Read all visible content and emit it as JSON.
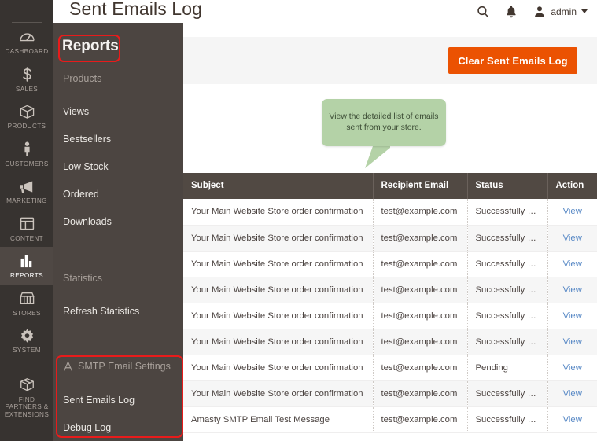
{
  "header": {
    "title": "Sent Emails Log",
    "search_icon": "search-icon",
    "notifications_icon": "bell-icon",
    "account_icon": "user-icon",
    "account_name": "admin",
    "caret_icon": "chevron-down-icon"
  },
  "rail": {
    "items": [
      {
        "label": "DASHBOARD",
        "icon": "dashboard-gauge-icon",
        "active": false
      },
      {
        "label": "SALES",
        "icon": "dollar-icon",
        "active": false
      },
      {
        "label": "PRODUCTS",
        "icon": "box-icon",
        "active": false
      },
      {
        "label": "CUSTOMERS",
        "icon": "person-icon",
        "active": false
      },
      {
        "label": "MARKETING",
        "icon": "megaphone-icon",
        "active": false
      },
      {
        "label": "CONTENT",
        "icon": "layout-icon",
        "active": false
      },
      {
        "label": "REPORTS",
        "icon": "bar-chart-icon",
        "active": true
      },
      {
        "label": "STORES",
        "icon": "storefront-icon",
        "active": false
      },
      {
        "label": "SYSTEM",
        "icon": "gear-icon",
        "active": false
      },
      {
        "label": "FIND PARTNERS & EXTENSIONS",
        "icon": "open-box-icon",
        "active": false
      }
    ]
  },
  "submenu": {
    "title": "Reports",
    "group_products": "Products",
    "link_views": "Views",
    "link_bestsellers": "Bestsellers",
    "link_low_stock": "Low Stock",
    "link_ordered": "Ordered",
    "link_downloads": "Downloads",
    "group_statistics": "Statistics",
    "link_refresh_statistics": "Refresh Statistics",
    "group_smtp": "SMTP Email Settings",
    "smtp_icon": "amasty-a-icon",
    "link_sent_emails_log": "Sent Emails Log",
    "link_debug_log": "Debug Log"
  },
  "toolbar": {
    "clear_label": "Clear Sent Emails Log",
    "accent_color": "#eb5202"
  },
  "tooltip": {
    "text": "View the detailed list of emails sent from your store.",
    "color": "#b4d2a7"
  },
  "annotations": {
    "color": "#e81b1b",
    "box_reports": "Reports",
    "box_smtp": "SMTP Email Settings section"
  },
  "table": {
    "columns": [
      "Subject",
      "Recipient Email",
      "Status",
      "Action"
    ],
    "action_label": "View",
    "rows": [
      {
        "subject": "Your Main Website Store order confirmation",
        "email": "test@example.com",
        "status": "Successfully Sent",
        "action": "View"
      },
      {
        "subject": "Your Main Website Store order confirmation",
        "email": "test@example.com",
        "status": "Successfully Sent",
        "action": "View"
      },
      {
        "subject": "Your Main Website Store order confirmation",
        "email": "test@example.com",
        "status": "Successfully Sent",
        "action": "View"
      },
      {
        "subject": "Your Main Website Store order confirmation",
        "email": "test@example.com",
        "status": "Successfully Sent",
        "action": "View"
      },
      {
        "subject": "Your Main Website Store order confirmation",
        "email": "test@example.com",
        "status": "Successfully Sent",
        "action": "View"
      },
      {
        "subject": "Your Main Website Store order confirmation",
        "email": "test@example.com",
        "status": "Successfully Sent",
        "action": "View"
      },
      {
        "subject": "Your Main Website Store order confirmation",
        "email": "test@example.com",
        "status": "Pending",
        "action": "View"
      },
      {
        "subject": "Your Main Website Store order confirmation",
        "email": "test@example.com",
        "status": "Successfully Sent",
        "action": "View"
      },
      {
        "subject": "Amasty SMTP Email Test Message",
        "email": "test@example.com",
        "status": "Successfully Sent",
        "action": "View"
      }
    ]
  }
}
